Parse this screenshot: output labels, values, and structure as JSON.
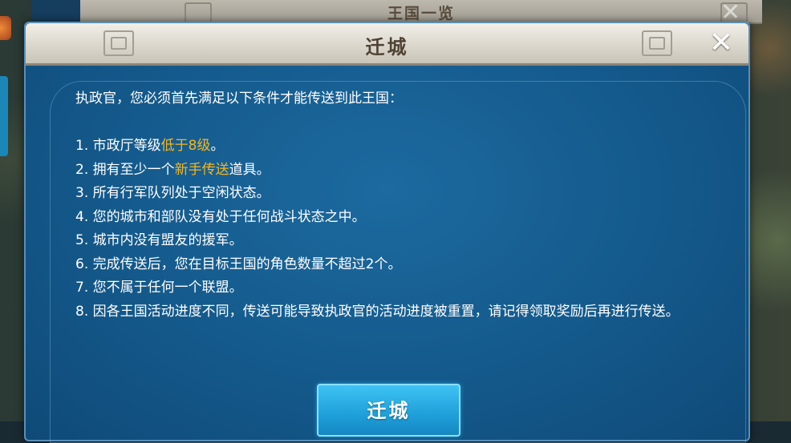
{
  "background_dialog": {
    "title": "王国一览",
    "close_symbol": "✕"
  },
  "dialog": {
    "title": "迁城",
    "close_symbol": "✕",
    "intro": "执政官，您必须首先满足以下条件才能传送到此王国：",
    "conditions": [
      {
        "before": "1. 市政厅等级",
        "highlight": "低于8级",
        "after": "。"
      },
      {
        "before": "2. 拥有至少一个",
        "highlight": "新手传送",
        "after": "道具。"
      },
      {
        "before": "3. 所有行军队列处于空闲状态。",
        "highlight": "",
        "after": ""
      },
      {
        "before": "4. 您的城市和部队没有处于任何战斗状态之中。",
        "highlight": "",
        "after": ""
      },
      {
        "before": "5. 城市内没有盟友的援军。",
        "highlight": "",
        "after": ""
      },
      {
        "before": "6. 完成传送后，您在目标王国的角色数量不超过2个。",
        "highlight": "",
        "after": ""
      },
      {
        "before": "7. 您不属于任何一个联盟。",
        "highlight": "",
        "after": ""
      },
      {
        "before": "8. 因各王国活动进度不同，传送可能导致执政官的活动进度被重置，请记得领取奖励后再进行传送。",
        "highlight": "",
        "after": ""
      }
    ],
    "confirm_button": "迁城"
  },
  "colors": {
    "highlight": "#f5b61f",
    "panel": "#14598b",
    "button": "#1e9fd9"
  }
}
